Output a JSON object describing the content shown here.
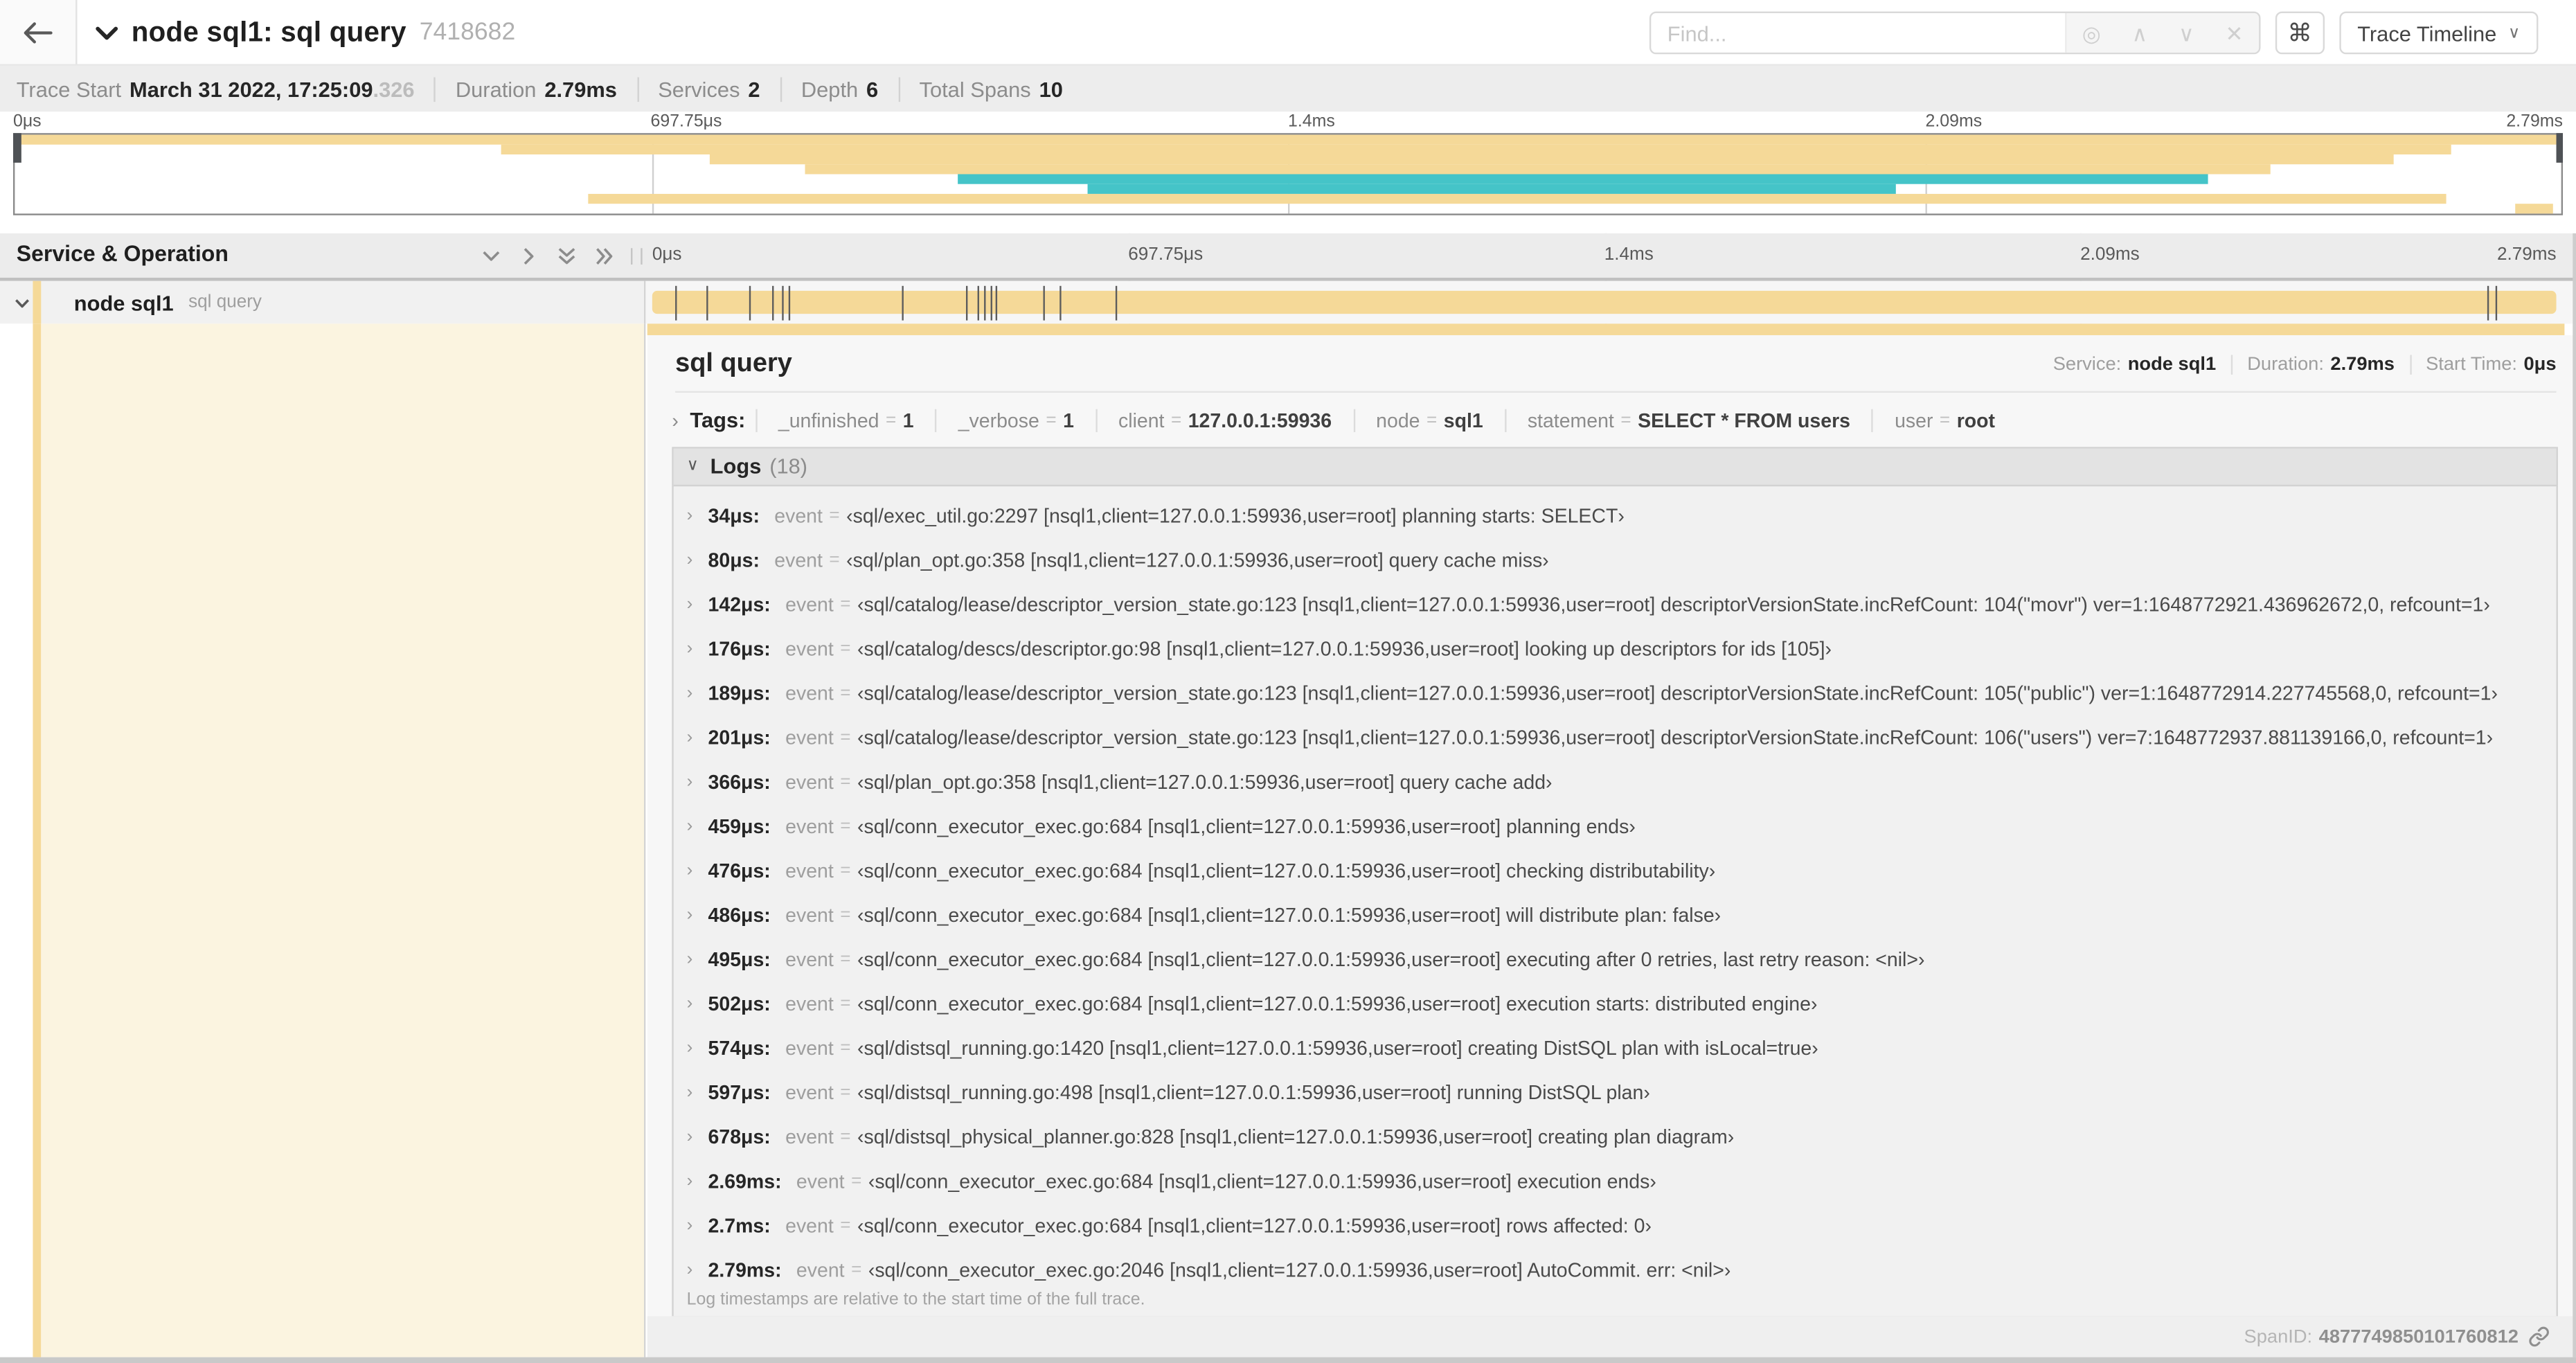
{
  "header": {
    "title": "node sql1: sql query",
    "trace_id": "7418682",
    "find_placeholder": "Find...",
    "shortcut_icon": "⌘",
    "view_selector": "Trace Timeline",
    "icons": {
      "locate": "◎",
      "prev": "∧",
      "next": "∨",
      "clear": "✕",
      "caret": "∨"
    }
  },
  "summary": {
    "items": [
      {
        "label": "Trace Start",
        "value": "March 31 2022, 17:25:09",
        "muted": ".326"
      },
      {
        "label": "Duration",
        "value": "2.79ms"
      },
      {
        "label": "Services",
        "value": "2"
      },
      {
        "label": "Depth",
        "value": "6"
      },
      {
        "label": "Total Spans",
        "value": "10"
      }
    ]
  },
  "timeline": {
    "ticks": [
      "0μs",
      "697.75μs",
      "1.4ms",
      "2.09ms",
      "2.79ms"
    ],
    "total_us": 2790,
    "log_marks_us": [
      34,
      80,
      142,
      176,
      189,
      201,
      366,
      459,
      476,
      486,
      495,
      502,
      574,
      597,
      678,
      2690,
      2700
    ],
    "colors": {
      "tan": "#f5d998",
      "teal": "#45c4c8",
      "cream": "#fbf4e0"
    },
    "minimap_bars": [
      {
        "row": 0,
        "start": 0,
        "end": 99.8,
        "color": "tan"
      },
      {
        "row": 1,
        "start": 19.1,
        "end": 95.7,
        "color": "tan"
      },
      {
        "row": 2,
        "start": 27.3,
        "end": 93.4,
        "color": "tan"
      },
      {
        "row": 3,
        "start": 31.0,
        "end": 88.6,
        "color": "tan"
      },
      {
        "row": 4,
        "start": 37.0,
        "end": 86.1,
        "color": "teal"
      },
      {
        "row": 5,
        "start": 42.1,
        "end": 73.9,
        "color": "teal"
      },
      {
        "row": 6,
        "start": 22.5,
        "end": 95.5,
        "color": "tan"
      },
      {
        "row": 7,
        "start": 98.2,
        "end": 99.7,
        "color": "tan"
      }
    ]
  },
  "left_header": {
    "title": "Service & Operation"
  },
  "row": {
    "service": "node sql1",
    "operation": "sql query"
  },
  "detail": {
    "operation": "sql query",
    "service_label": "Service:",
    "service": "node sql1",
    "duration_label": "Duration:",
    "duration": "2.79ms",
    "start_label": "Start Time:",
    "start": "0μs",
    "tags_label": "Tags:",
    "tags": [
      {
        "key": "_unfinished",
        "value": "1"
      },
      {
        "key": "_verbose",
        "value": "1"
      },
      {
        "key": "client",
        "value": "127.0.0.1:59936"
      },
      {
        "key": "node",
        "value": "sql1"
      },
      {
        "key": "statement",
        "value": "SELECT * FROM users"
      },
      {
        "key": "user",
        "value": "root"
      }
    ],
    "logs_label": "Logs",
    "logs_count": "(18)",
    "logs_key": "event",
    "logs": [
      {
        "t": "34μs",
        "v": "‹sql/exec_util.go:2297 [nsql1,client=127.0.0.1:59936,user=root] planning starts: SELECT›"
      },
      {
        "t": "80μs",
        "v": "‹sql/plan_opt.go:358 [nsql1,client=127.0.0.1:59936,user=root] query cache miss›"
      },
      {
        "t": "142μs",
        "v": "‹sql/catalog/lease/descriptor_version_state.go:123 [nsql1,client=127.0.0.1:59936,user=root] descriptorVersionState.incRefCount: 104(\"movr\") ver=1:1648772921.436962672,0, refcount=1›"
      },
      {
        "t": "176μs",
        "v": "‹sql/catalog/descs/descriptor.go:98 [nsql1,client=127.0.0.1:59936,user=root] looking up descriptors for ids [105]›"
      },
      {
        "t": "189μs",
        "v": "‹sql/catalog/lease/descriptor_version_state.go:123 [nsql1,client=127.0.0.1:59936,user=root] descriptorVersionState.incRefCount: 105(\"public\") ver=1:1648772914.227745568,0, refcount=1›"
      },
      {
        "t": "201μs",
        "v": "‹sql/catalog/lease/descriptor_version_state.go:123 [nsql1,client=127.0.0.1:59936,user=root] descriptorVersionState.incRefCount: 106(\"users\") ver=7:1648772937.881139166,0, refcount=1›"
      },
      {
        "t": "366μs",
        "v": "‹sql/plan_opt.go:358 [nsql1,client=127.0.0.1:59936,user=root] query cache add›"
      },
      {
        "t": "459μs",
        "v": "‹sql/conn_executor_exec.go:684 [nsql1,client=127.0.0.1:59936,user=root] planning ends›"
      },
      {
        "t": "476μs",
        "v": "‹sql/conn_executor_exec.go:684 [nsql1,client=127.0.0.1:59936,user=root] checking distributability›"
      },
      {
        "t": "486μs",
        "v": "‹sql/conn_executor_exec.go:684 [nsql1,client=127.0.0.1:59936,user=root] will distribute plan: false›"
      },
      {
        "t": "495μs",
        "v": "‹sql/conn_executor_exec.go:684 [nsql1,client=127.0.0.1:59936,user=root] executing after 0 retries, last retry reason: <nil>›"
      },
      {
        "t": "502μs",
        "v": "‹sql/conn_executor_exec.go:684 [nsql1,client=127.0.0.1:59936,user=root] execution starts: distributed engine›"
      },
      {
        "t": "574μs",
        "v": "‹sql/distsql_running.go:1420 [nsql1,client=127.0.0.1:59936,user=root] creating DistSQL plan with isLocal=true›"
      },
      {
        "t": "597μs",
        "v": "‹sql/distsql_running.go:498 [nsql1,client=127.0.0.1:59936,user=root] running DistSQL plan›"
      },
      {
        "t": "678μs",
        "v": "‹sql/distsql_physical_planner.go:828 [nsql1,client=127.0.0.1:59936,user=root] creating plan diagram›"
      },
      {
        "t": "2.69ms",
        "v": "‹sql/conn_executor_exec.go:684 [nsql1,client=127.0.0.1:59936,user=root] execution ends›"
      },
      {
        "t": "2.7ms",
        "v": "‹sql/conn_executor_exec.go:684 [nsql1,client=127.0.0.1:59936,user=root] rows affected: 0›"
      },
      {
        "t": "2.79ms",
        "v": "‹sql/conn_executor_exec.go:2046 [nsql1,client=127.0.0.1:59936,user=root] AutoCommit. err: <nil>›"
      }
    ],
    "footnote": "Log timestamps are relative to the start time of the full trace.",
    "spanid_label": "SpanID:",
    "spanid": "4877749850101760812"
  }
}
